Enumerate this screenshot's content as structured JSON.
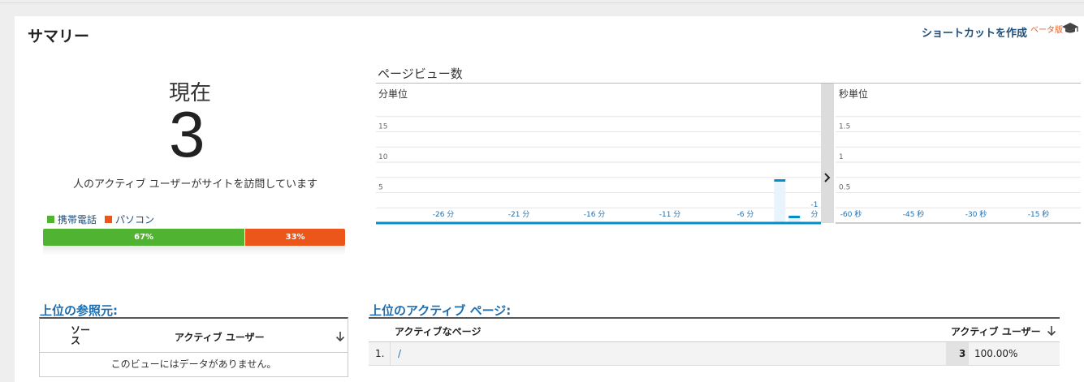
{
  "header": {
    "title": "サマリー",
    "shortcut_label": "ショートカットを作成",
    "beta_label": "ベータ版",
    "help_icon": "graduation-cap-icon"
  },
  "summary": {
    "now_label": "現在",
    "active_users": "3",
    "description": "人のアクティブ ユーザーがサイトを訪問しています",
    "devices": [
      {
        "label": "携帯電話",
        "color": "#50b432",
        "percent_text": "67%",
        "share": 0.67
      },
      {
        "label": "パソコン",
        "color": "#ed561b",
        "percent_text": "33%",
        "share": 0.33
      }
    ]
  },
  "pageviews": {
    "title": "ページビュー数",
    "per_minute_label": "分単位",
    "per_second_label": "秒単位",
    "expand_icon": "chevron-right-icon"
  },
  "chart_data": [
    {
      "type": "bar",
      "title": "",
      "label": "分単位",
      "x_ticks": [
        "-26 分",
        "-21 分",
        "-16 分",
        "-11 分",
        "-6 分",
        "-1 分"
      ],
      "y_ticks": [
        "5",
        "10",
        "15"
      ],
      "ylim": [
        0,
        20
      ],
      "grid": true,
      "x": [
        -30,
        -29,
        -28,
        -27,
        -26,
        -25,
        -24,
        -23,
        -22,
        -21,
        -20,
        -19,
        -18,
        -17,
        -16,
        -15,
        -14,
        -13,
        -12,
        -11,
        -10,
        -9,
        -8,
        -7,
        -6,
        -5,
        -4,
        -3,
        -2,
        -1
      ],
      "values": [
        0,
        0,
        0,
        0,
        0,
        0,
        0,
        0,
        0,
        0,
        0,
        0,
        0,
        0,
        0,
        0,
        0,
        0,
        0,
        0,
        0,
        0,
        0,
        0,
        0,
        0,
        0,
        7,
        1,
        0
      ],
      "color": "#058dc7"
    },
    {
      "type": "bar",
      "title": "",
      "label": "秒単位",
      "x_ticks": [
        "-60 秒",
        "-45 秒",
        "-30 秒",
        "-15 秒"
      ],
      "y_ticks": [
        "0.5",
        "1",
        "1.5"
      ],
      "ylim": [
        0,
        2
      ],
      "grid": true,
      "values": [],
      "color": "#058dc7"
    }
  ],
  "referrers": {
    "title": "上位の参照元:",
    "col_source": "ソース",
    "col_users": "アクティブ ユーザー",
    "empty_text": "このビューにはデータがありません。"
  },
  "active_pages": {
    "title": "上位のアクティブ ページ:",
    "col_page": "アクティブなページ",
    "col_users": "アクティブ ユーザー",
    "rows": [
      {
        "index": "1.",
        "page": "/",
        "users": "3",
        "percent": "100.00%"
      }
    ]
  }
}
